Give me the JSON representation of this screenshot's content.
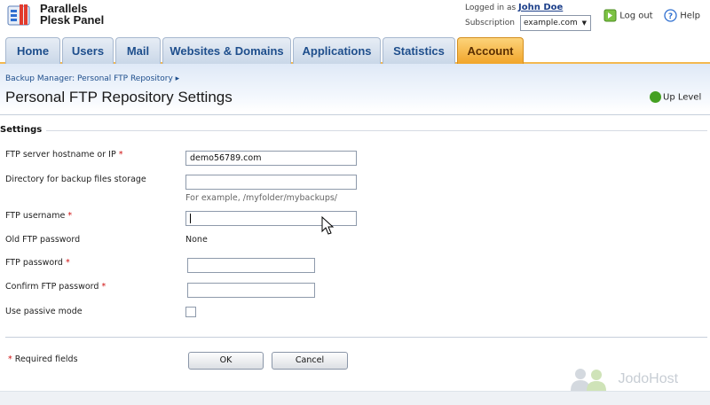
{
  "header": {
    "brand_line1": "Parallels",
    "brand_line2": "Plesk Panel",
    "logged_in_label": "Logged in as",
    "user_name": "John Doe",
    "subscription_label": "Subscription",
    "subscription_value": "example.com",
    "logout_label": "Log out",
    "help_label": "Help"
  },
  "tabs": [
    {
      "label": "Home"
    },
    {
      "label": "Users"
    },
    {
      "label": "Mail"
    },
    {
      "label": "Websites & Domains"
    },
    {
      "label": "Applications"
    },
    {
      "label": "Statistics"
    },
    {
      "label": "Account",
      "active": true
    }
  ],
  "breadcrumb": {
    "path": "Backup Manager: Personal FTP Repository ▸"
  },
  "page": {
    "title": "Personal FTP Repository Settings",
    "up_level_label": "Up Level"
  },
  "form": {
    "section_title": "Settings",
    "fields": {
      "hostname": {
        "label": "FTP server hostname or IP",
        "value": "demo56789.com"
      },
      "directory": {
        "label": "Directory for backup files storage",
        "value": "",
        "hint": "For example, /myfolder/mybackups/"
      },
      "username": {
        "label": "FTP username",
        "value": ""
      },
      "old_password": {
        "label": "Old FTP password",
        "value": "None"
      },
      "password": {
        "label": "FTP password",
        "value": ""
      },
      "confirm_password": {
        "label": "Confirm FTP password",
        "value": ""
      },
      "passive_mode": {
        "label": "Use passive mode",
        "checked": false
      }
    },
    "required_note": "Required fields",
    "ok_label": "OK",
    "cancel_label": "Cancel"
  },
  "watermark": {
    "text": "JodoHost"
  },
  "colors": {
    "tab_bg": "#c9d7e8",
    "tab_active": "#f1a52a",
    "link": "#1e4e8c",
    "required": "#d01010"
  }
}
